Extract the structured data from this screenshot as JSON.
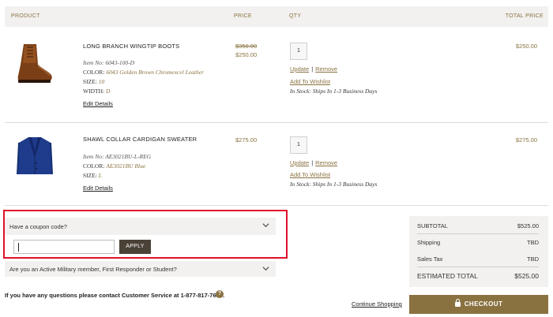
{
  "header": {
    "product": "PRODUCT",
    "price": "PRICE",
    "qty": "QTY",
    "total_price": "TOTAL PRICE"
  },
  "items": [
    {
      "name": "LONG BRANCH WINGTIP BOOTS",
      "item_no_label": "Item No:",
      "item_no": "6043-100-D",
      "color_label": "COLOR:",
      "color": "6043 Golden Brown Chromexcel Leather",
      "size_label": "SIZE:",
      "size": "10",
      "width_label": "WIDTH:",
      "width": "D",
      "edit_label": "Edit Details",
      "original_price": "$350.00",
      "price": "$250.00",
      "qty": "1",
      "update_label": "Update",
      "remove_label": "Remove",
      "wishlist_label": "Add To Wishlist",
      "stock": "In Stock: Ships In 1-3 Business Days",
      "total": "$250.00",
      "image_icon": "brown-boot-image"
    },
    {
      "name": "SHAWL COLLAR CARDIGAN SWEATER",
      "item_no_label": "Item No:",
      "item_no": "AE3021BU-L-REG",
      "color_label": "COLOR:",
      "color": "AE3021BU Blue",
      "size_label": "SIZE:",
      "size": "L",
      "edit_label": "Edit Details",
      "price": "$275.00",
      "qty": "1",
      "update_label": "Update",
      "remove_label": "Remove",
      "wishlist_label": "Add To Wishlist",
      "stock": "In Stock: Ships In 1-3 Business Days",
      "total": "$275.00",
      "image_icon": "blue-sweater-image"
    }
  ],
  "coupon": {
    "question": "Have a coupon code?",
    "input_value": "",
    "apply_label": "APPLY"
  },
  "military": {
    "question": "Are you an Active Military member, First Responder or Student?"
  },
  "contact_text": "If you have any questions please contact Customer Service at 1-877-817-7615.",
  "help_icon": "?",
  "continue_label": "Continue Shopping",
  "summary": {
    "subtotal_label": "SUBTOTAL",
    "subtotal": "$525.00",
    "shipping_label": "Shipping",
    "shipping": "TBD",
    "tax_label": "Sales Tax",
    "tax": "TBD",
    "total_label": "ESTIMATED TOTAL",
    "total": "$525.00"
  },
  "checkout_label": "CHECKOUT",
  "colors": {
    "accent": "#8a7240",
    "panel": "#f2f1ef",
    "apply_button": "#4a4137",
    "highlight": "#e0102a"
  }
}
